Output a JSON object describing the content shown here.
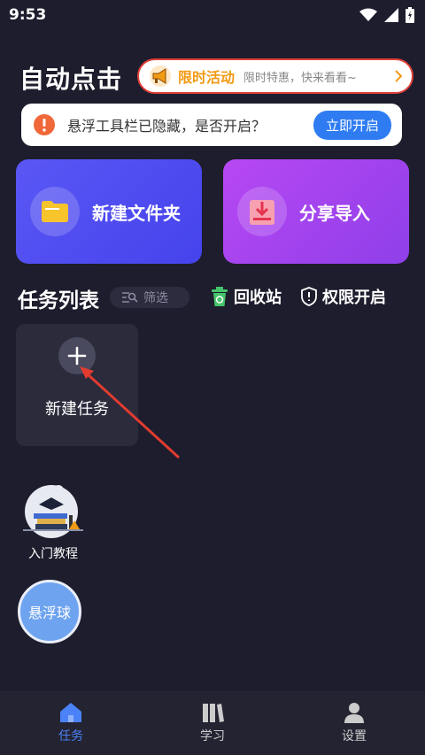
{
  "status_bar": {
    "time": "9:53"
  },
  "header": {
    "title": "自动点击"
  },
  "promo": {
    "title": "限时活动",
    "subtitle": "限时特惠，快来看看~"
  },
  "notice": {
    "text": "悬浮工具栏已隐藏，是否开启？",
    "button": "立即开启"
  },
  "cards": {
    "new_folder": "新建文件夹",
    "share_import": "分享导入"
  },
  "tasks": {
    "title": "任务列表",
    "filter": "筛选",
    "recycle_bin": "回收站",
    "permissions": "权限开启",
    "new_task": "新建任务"
  },
  "tutorial": {
    "label": "入门教程"
  },
  "float_ball": {
    "label": "悬浮球"
  },
  "tabbar": {
    "items": [
      {
        "label": "任务",
        "icon": "home-icon",
        "active": true
      },
      {
        "label": "学习",
        "icon": "books-icon",
        "active": false
      },
      {
        "label": "设置",
        "icon": "person-icon",
        "active": false
      }
    ]
  },
  "colors": {
    "accent": "#4b82f7",
    "promo_border": "#e2403a",
    "promo_text": "#f29a14",
    "card_blue": "#4f4df0",
    "card_purple": "#a445ee"
  }
}
